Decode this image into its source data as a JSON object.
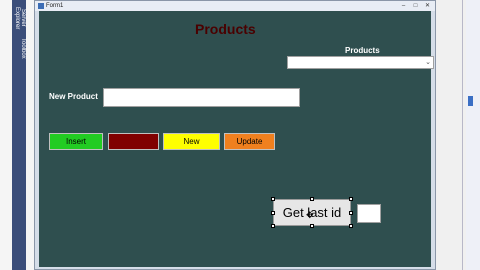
{
  "ide": {
    "left_tabs": [
      "Server Explorer",
      "Toolbox"
    ]
  },
  "window": {
    "title": "Form1",
    "controls": {
      "minimize": "–",
      "maximize": "□",
      "close": "✕"
    }
  },
  "form": {
    "heading": "Products",
    "combo_label": "Products",
    "combo_value": "",
    "new_product_label": "New Product",
    "new_product_value": "",
    "buttons": {
      "insert": "Insert",
      "delete": "",
      "new": "New",
      "update": "Update"
    },
    "get_last_id": "Get last id",
    "last_id_value": ""
  },
  "colors": {
    "form_background": "#2f4f4f",
    "heading": "#4a0000",
    "insert": "#22cc22",
    "delete": "#800000",
    "new": "#ffff00",
    "update": "#f0801e"
  },
  "icons": {
    "cursor": "move-cursor-icon",
    "dropdown": "chevron-down-icon"
  }
}
